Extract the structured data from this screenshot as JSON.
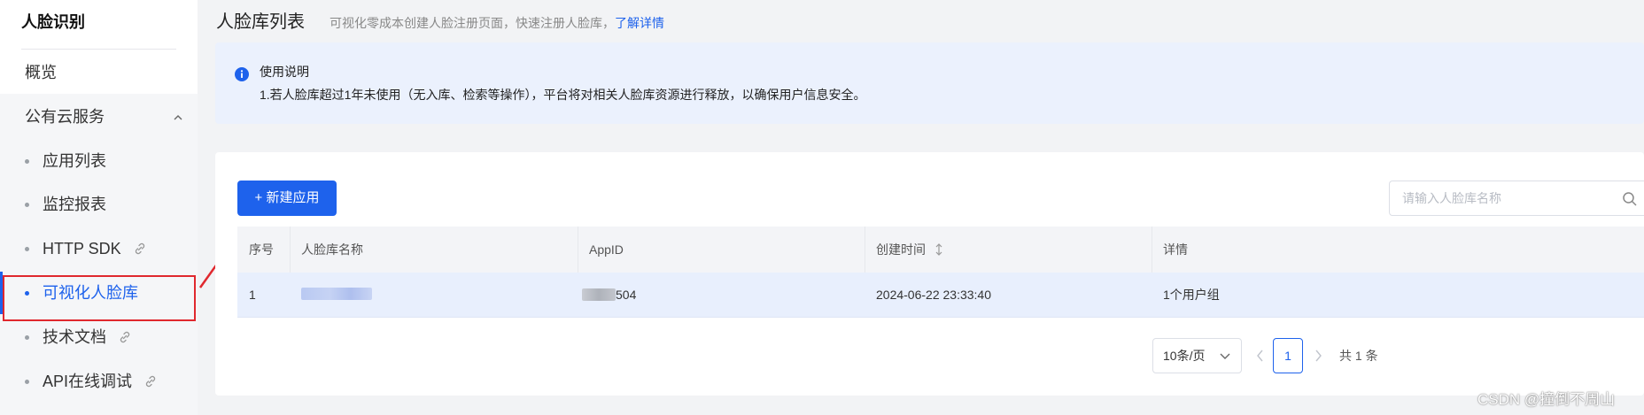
{
  "sidebar": {
    "title": "人脸识别",
    "overview": "概览",
    "group": "公有云服务",
    "items": [
      {
        "label": "应用列表",
        "link": false
      },
      {
        "label": "监控报表",
        "link": false
      },
      {
        "label": "HTTP SDK",
        "link": true
      },
      {
        "label": "可视化人脸库",
        "link": false,
        "active": true
      },
      {
        "label": "技术文档",
        "link": true
      },
      {
        "label": "API在线调试",
        "link": true
      }
    ]
  },
  "header": {
    "title": "人脸库列表",
    "desc": "可视化零成本创建人脸注册页面，快速注册人脸库，",
    "link": "了解详情"
  },
  "notice": {
    "title": "使用说明",
    "text": "1.若人脸库超过1年未使用（无入库、检索等操作），平台将对相关人脸库资源进行释放，以确保用户信息安全。"
  },
  "toolbar": {
    "new_label": "+ 新建应用",
    "search_placeholder": "请输入人脸库名称"
  },
  "table": {
    "headers": [
      "序号",
      "人脸库名称",
      "AppID",
      "创建时间",
      "详情"
    ],
    "rows": [
      {
        "index": "1",
        "name": "",
        "appid": "504",
        "created": "2024-06-22 23:33:40",
        "detail": "1个用户组"
      }
    ]
  },
  "pagination": {
    "page_size": "10条/页",
    "current": "1",
    "total": "共 1 条"
  },
  "watermark": "CSDN @撞倒不周山",
  "colors": {
    "accent": "#1e62ec",
    "highlight": "#e0282e",
    "notice_bg": "#ebf1fd"
  }
}
